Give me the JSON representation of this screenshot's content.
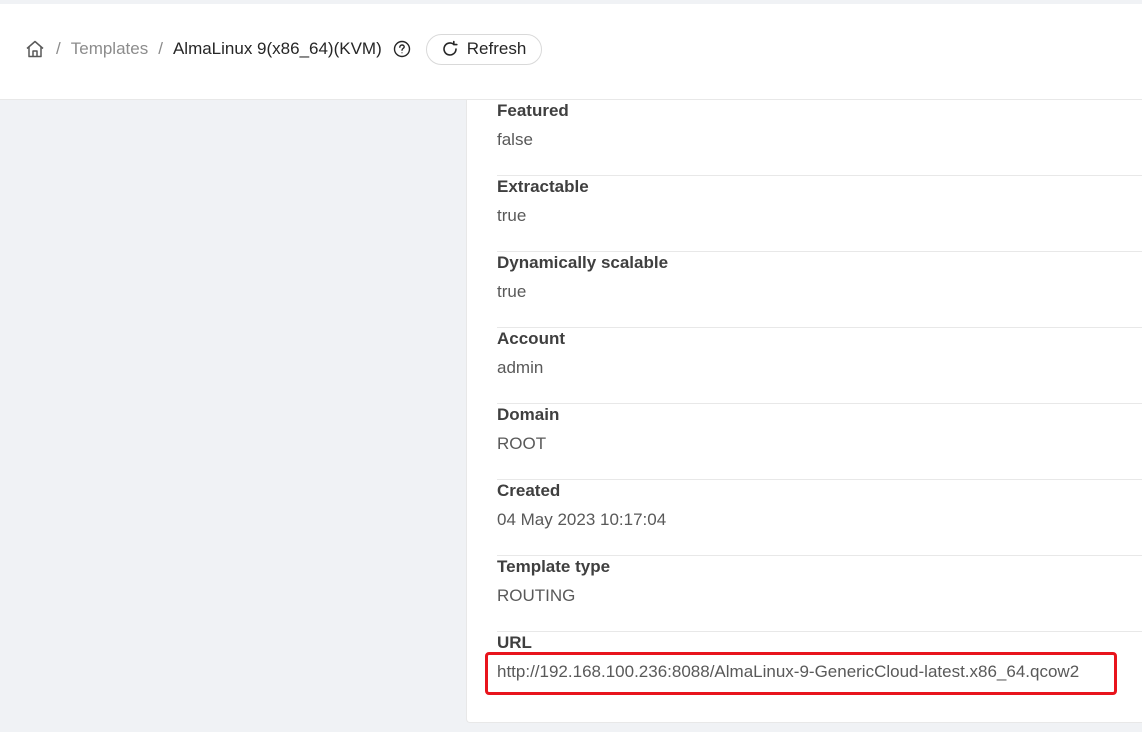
{
  "breadcrumb": {
    "home_icon": "home-icon",
    "separator": "/",
    "parent": "Templates",
    "current": "AlmaLinux 9(x86_64)(KVM)",
    "help_icon": "question-circle-icon"
  },
  "toolbar": {
    "refresh_label": "Refresh",
    "refresh_icon": "reload-icon"
  },
  "details": [
    {
      "label": "Featured",
      "value": "false"
    },
    {
      "label": "Extractable",
      "value": "true"
    },
    {
      "label": "Dynamically scalable",
      "value": "true"
    },
    {
      "label": "Account",
      "value": "admin"
    },
    {
      "label": "Domain",
      "value": "ROOT"
    },
    {
      "label": "Created",
      "value": "04 May 2023 10:17:04"
    },
    {
      "label": "Template type",
      "value": "ROUTING"
    },
    {
      "label": "URL",
      "value": "http://192.168.100.236:8088/AlmaLinux-9-GenericCloud-latest.x86_64.qcow2"
    }
  ],
  "colors": {
    "highlight": "#e8141c",
    "background": "#f0f2f5",
    "panel": "#ffffff"
  }
}
